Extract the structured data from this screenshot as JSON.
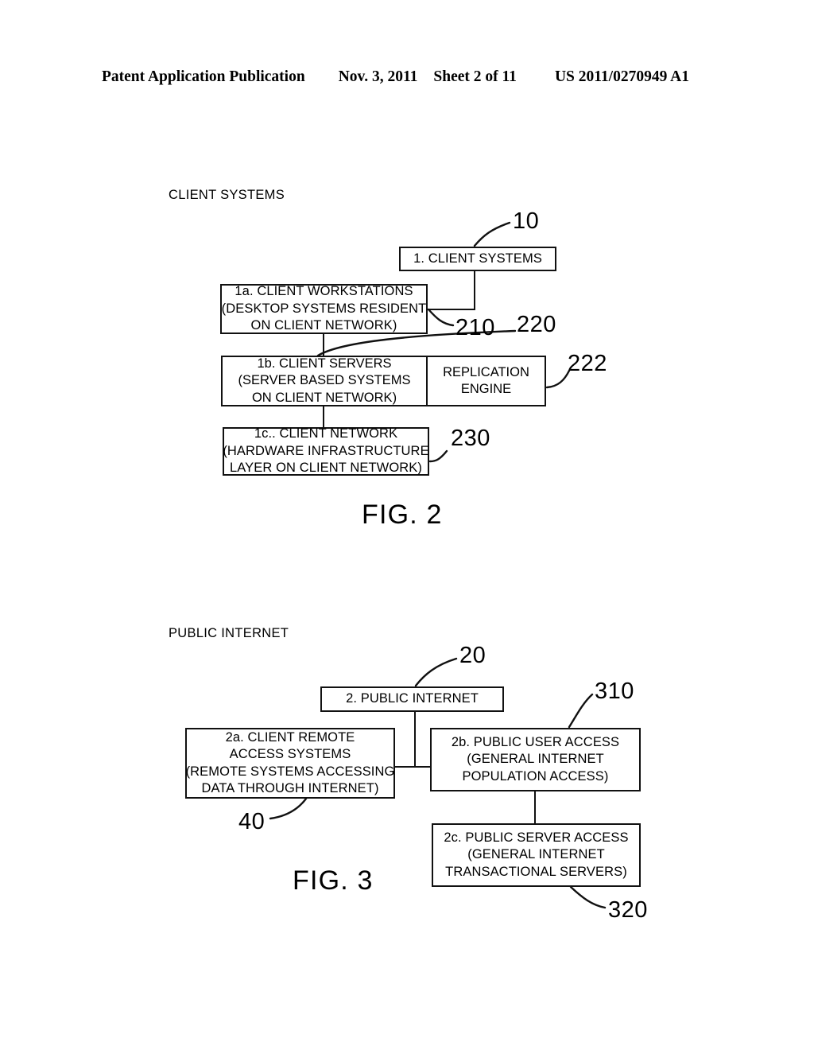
{
  "header": {
    "title": "Patent Application Publication",
    "date": "Nov. 3, 2011",
    "sheet": "Sheet 2 of 11",
    "publication_number": "US 2011/0270949 A1"
  },
  "ink_color": "#111111",
  "paper_color": "#ffffff",
  "figures": [
    {
      "id": "fig2",
      "caption": "CLIENT SYSTEMS",
      "label": "FIG. 2",
      "nodes": [
        {
          "key": "client_systems",
          "lines": [
            "1.  CLIENT SYSTEMS"
          ],
          "ref": "10"
        },
        {
          "key": "client_workstations",
          "lines": [
            "1a.  CLIENT WORKSTATIONS",
            "(DESKTOP SYSTEMS RESIDENT",
            "ON CLIENT NETWORK)"
          ],
          "ref": "210"
        },
        {
          "key": "client_servers",
          "lines": [
            "1b.  CLIENT SERVERS",
            "(SERVER BASED SYSTEMS",
            "ON CLIENT NETWORK)"
          ],
          "ref": "220"
        },
        {
          "key": "replication_engine",
          "lines": [
            "REPLICATION",
            "ENGINE"
          ],
          "ref": "222"
        },
        {
          "key": "client_network",
          "lines": [
            "1c..  CLIENT NETWORK",
            "(HARDWARE INFRASTRUCTURE",
            "LAYER ON CLIENT NETWORK)"
          ],
          "ref": "230"
        }
      ]
    },
    {
      "id": "fig3",
      "caption": "PUBLIC INTERNET",
      "label": "FIG. 3",
      "nodes": [
        {
          "key": "public_internet",
          "lines": [
            "2.  PUBLIC INTERNET"
          ],
          "ref": "20"
        },
        {
          "key": "client_remote_access",
          "lines": [
            "2a.  CLIENT REMOTE",
            "ACCESS SYSTEMS",
            "(REMOTE SYSTEMS ACCESSING",
            "DATA THROUGH INTERNET)"
          ],
          "ref": "40"
        },
        {
          "key": "public_user_access",
          "lines": [
            "2b.  PUBLIC USER ACCESS",
            "(GENERAL INTERNET",
            "POPULATION ACCESS)"
          ],
          "ref": "310"
        },
        {
          "key": "public_server_access",
          "lines": [
            "2c.  PUBLIC SERVER ACCESS",
            "(GENERAL INTERNET",
            "TRANSACTIONAL SERVERS)"
          ],
          "ref": "320"
        }
      ]
    }
  ],
  "fig2": {
    "caption": "CLIENT SYSTEMS",
    "label": "FIG. 2",
    "client_systems": {
      "l0": "1.  CLIENT SYSTEMS"
    },
    "client_workstations": {
      "l0": "1a.  CLIENT WORKSTATIONS",
      "l1": "(DESKTOP SYSTEMS RESIDENT",
      "l2": "ON CLIENT NETWORK)"
    },
    "client_servers": {
      "l0": "1b.  CLIENT SERVERS",
      "l1": "(SERVER BASED SYSTEMS",
      "l2": "ON CLIENT NETWORK)"
    },
    "replication_engine": {
      "l0": "REPLICATION",
      "l1": "ENGINE"
    },
    "client_network": {
      "l0": "1c..  CLIENT NETWORK",
      "l1": "(HARDWARE INFRASTRUCTURE",
      "l2": "LAYER ON CLIENT NETWORK)"
    },
    "refs": {
      "r10": "10",
      "r210": "210",
      "r220": "220",
      "r222": "222",
      "r230": "230"
    }
  },
  "fig3": {
    "caption": "PUBLIC INTERNET",
    "label": "FIG. 3",
    "public_internet": {
      "l0": "2.  PUBLIC INTERNET"
    },
    "client_remote_access": {
      "l0": "2a.  CLIENT REMOTE",
      "l1": "ACCESS SYSTEMS",
      "l2": "(REMOTE SYSTEMS ACCESSING",
      "l3": "DATA THROUGH INTERNET)"
    },
    "public_user_access": {
      "l0": "2b.  PUBLIC USER ACCESS",
      "l1": "(GENERAL INTERNET",
      "l2": "POPULATION ACCESS)"
    },
    "public_server_access": {
      "l0": "2c.  PUBLIC SERVER ACCESS",
      "l1": "(GENERAL INTERNET",
      "l2": "TRANSACTIONAL SERVERS)"
    },
    "refs": {
      "r20": "20",
      "r310": "310",
      "r40": "40",
      "r320": "320"
    }
  }
}
